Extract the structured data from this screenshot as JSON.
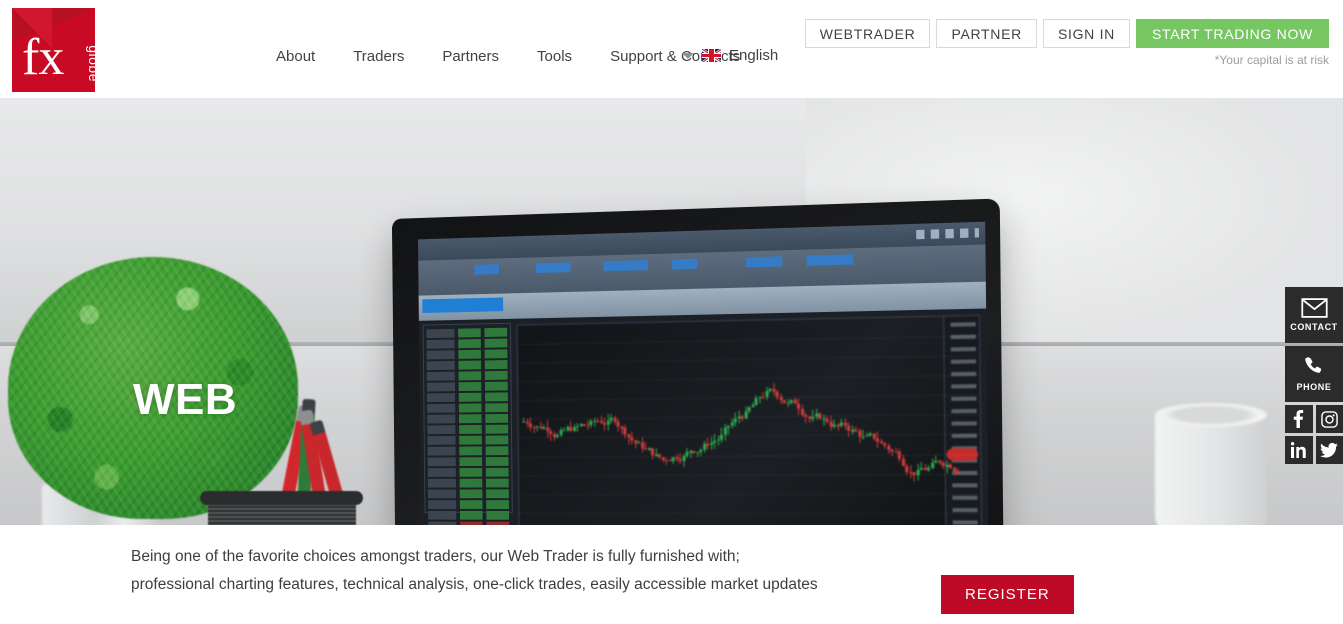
{
  "brand": {
    "logo_primary": "fx",
    "logo_secondary": "globe",
    "logo_color": "#c80a24"
  },
  "header": {
    "nav": [
      {
        "label": "About"
      },
      {
        "label": "Traders"
      },
      {
        "label": "Partners"
      },
      {
        "label": "Tools"
      },
      {
        "label": "Support & Contacts"
      }
    ],
    "language": {
      "label": "English",
      "flag": "uk-flag-icon",
      "caret": "chevron-down-icon"
    },
    "buttons": [
      {
        "label": "WEBTRADER",
        "style": "outline"
      },
      {
        "label": "PARTNER",
        "style": "outline"
      },
      {
        "label": "SIGN IN",
        "style": "outline"
      },
      {
        "label": "START TRADING NOW",
        "style": "cta",
        "color": "#76c761"
      }
    ],
    "risk_note": "*Your capital is at risk"
  },
  "hero": {
    "title": "WEB",
    "image_description": "Laptop on a white desk showing a dark trading platform with candlestick chart, next to a green topiary plant and a mesh cup of pencils"
  },
  "rail": {
    "contact": {
      "label": "CONTACT",
      "icon": "envelope-icon"
    },
    "phone": {
      "label": "PHONE",
      "icon": "phone-icon"
    },
    "social": [
      {
        "name": "facebook-icon"
      },
      {
        "name": "instagram-icon"
      },
      {
        "name": "linkedin-icon"
      },
      {
        "name": "twitter-icon"
      }
    ]
  },
  "content": {
    "paragraph_line1": "Being one of the favorite choices amongst traders, our Web Trader is fully furnished with;",
    "paragraph_line2": "professional charting features, technical analysis, one-click trades, easily accessible market updates",
    "register_label": "REGISTER",
    "register_color": "#be0a26"
  }
}
